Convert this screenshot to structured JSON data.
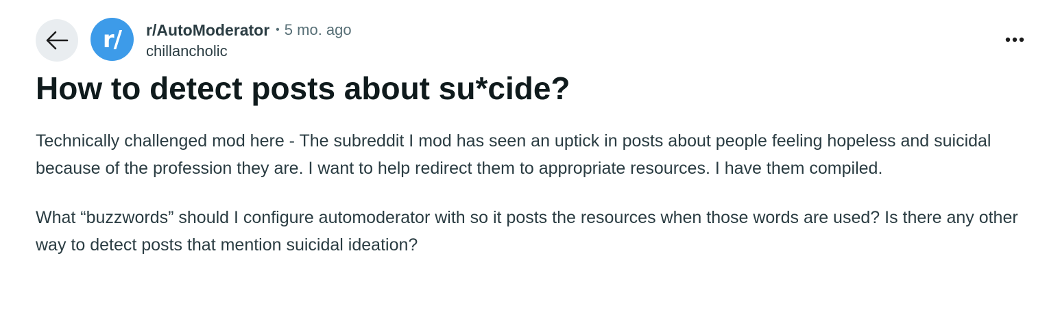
{
  "header": {
    "back_icon": "arrow-left-icon",
    "avatar_text": "r/",
    "avatar_color": "#3d9be9",
    "subreddit": "r/AutoModerator",
    "separator": "•",
    "timestamp": "5 mo. ago",
    "author": "chillancholic",
    "overflow_icon": "ellipsis-horizontal-icon"
  },
  "post": {
    "title": "How to detect posts about su*cide?",
    "paragraphs": [
      "Technically challenged mod here - The subreddit I mod has seen an uptick in posts about people feeling hopeless and suicidal because of the profession they are. I want to help redirect them to appropriate resources. I have them compiled.",
      "What “buzzwords” should I configure automoderator with so it posts the resources when those words are used? Is there any other way to detect posts that mention suicidal ideation?"
    ]
  },
  "colors": {
    "back_button_bg": "#e9edf0",
    "title_text": "#0f1a1c",
    "body_text": "#2a3c42",
    "meta_text": "#576f76"
  }
}
